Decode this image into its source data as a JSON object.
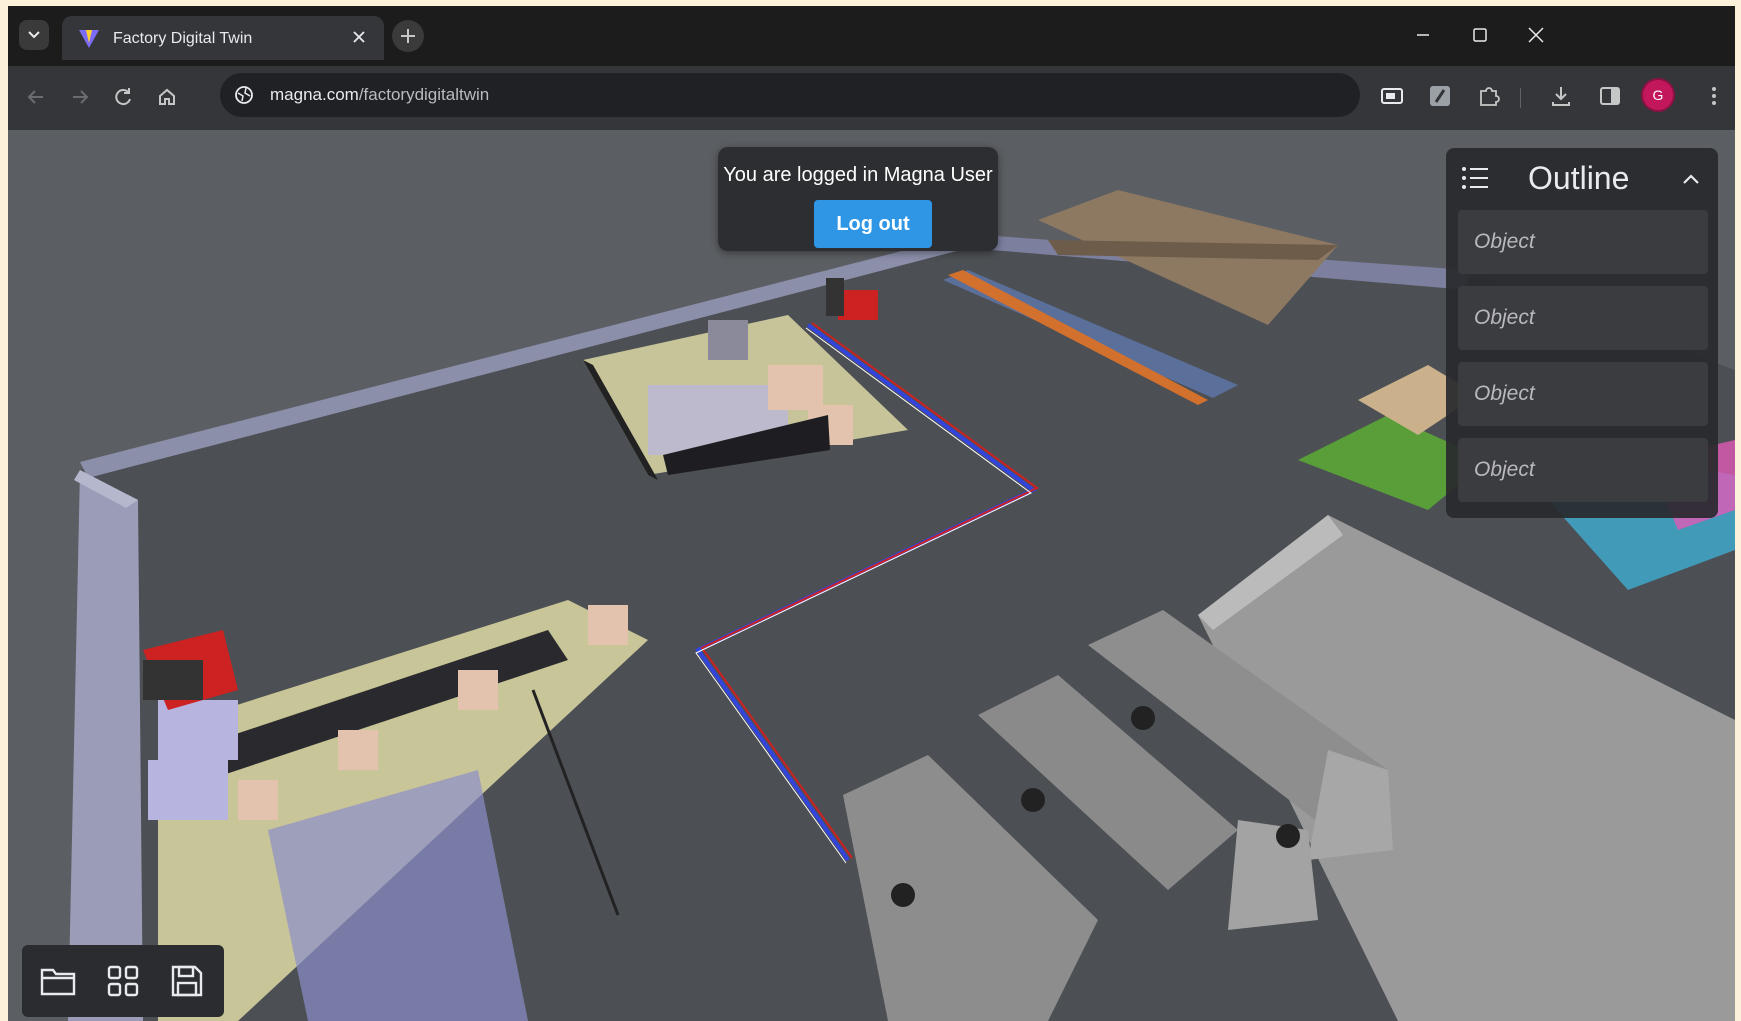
{
  "browser": {
    "tab_title": "Factory Digital Twin",
    "url_host": "magna.com",
    "url_path": "/factorydigitaltwin",
    "profile_initial": "G"
  },
  "login": {
    "message": "You are logged in Magna User",
    "logout_label": "Log out"
  },
  "outline": {
    "title": "Outline",
    "items": [
      {
        "label": "Object"
      },
      {
        "label": "Object"
      },
      {
        "label": "Object"
      },
      {
        "label": "Object"
      }
    ]
  },
  "icons": {
    "tab_menu": "chevron-down-icon",
    "new_tab": "plus-icon",
    "tools": [
      "folder-icon",
      "grid-icon",
      "save-icon"
    ]
  },
  "colors": {
    "accent": "#2f96e6",
    "profile": "#c2185b",
    "path_blue": "#3344dd",
    "path_red": "#cc2222"
  }
}
